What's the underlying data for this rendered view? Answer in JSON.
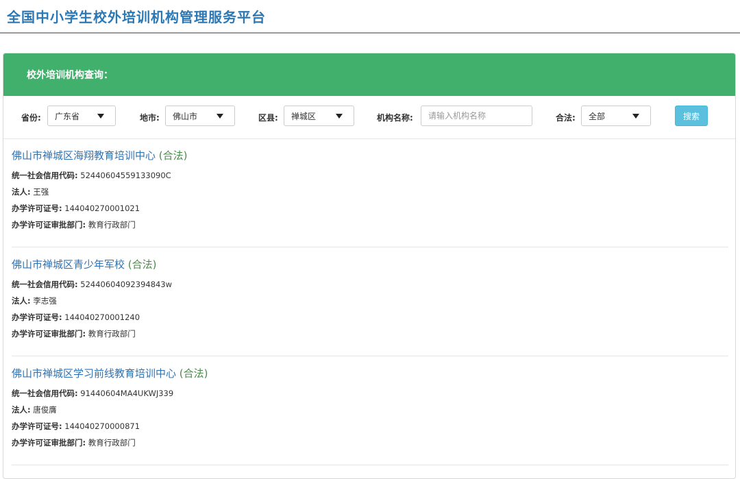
{
  "header": {
    "title": "全国中小学生校外培训机构管理服务平台"
  },
  "panel": {
    "heading": "校外培训机构查询："
  },
  "filters": {
    "province": {
      "label": "省份:",
      "value": "广东省"
    },
    "city": {
      "label": "地市:",
      "value": "佛山市"
    },
    "district": {
      "label": "区县:",
      "value": "禅城区"
    },
    "name": {
      "label": "机构名称:",
      "placeholder": "请输入机构名称",
      "value": ""
    },
    "legal": {
      "label": "合法:",
      "value": "全部"
    },
    "search_label": "搜索"
  },
  "field_labels": {
    "credit_code": "统一社会信用代码:",
    "legal_person": "法人:",
    "license_no": "办学许可证号:",
    "approval_dept": "办学许可证审批部门:"
  },
  "results": [
    {
      "name": "佛山市禅城区海翔教育培训中心",
      "status": "(合法)",
      "credit_code": "52440604559133090C",
      "legal_person": "王强",
      "license_no": "144040270001021",
      "approval_dept": "教育行政部门"
    },
    {
      "name": "佛山市禅城区青少年军校",
      "status": "(合法)",
      "credit_code": "52440604092394843w",
      "legal_person": "李志强",
      "license_no": "144040270001240",
      "approval_dept": "教育行政部门"
    },
    {
      "name": "佛山市禅城区学习前线教育培训中心",
      "status": "(合法)",
      "credit_code": "91440604MA4UKWJ339",
      "legal_person": "唐俊膺",
      "license_no": "144040270000871",
      "approval_dept": "教育行政部门"
    }
  ]
}
